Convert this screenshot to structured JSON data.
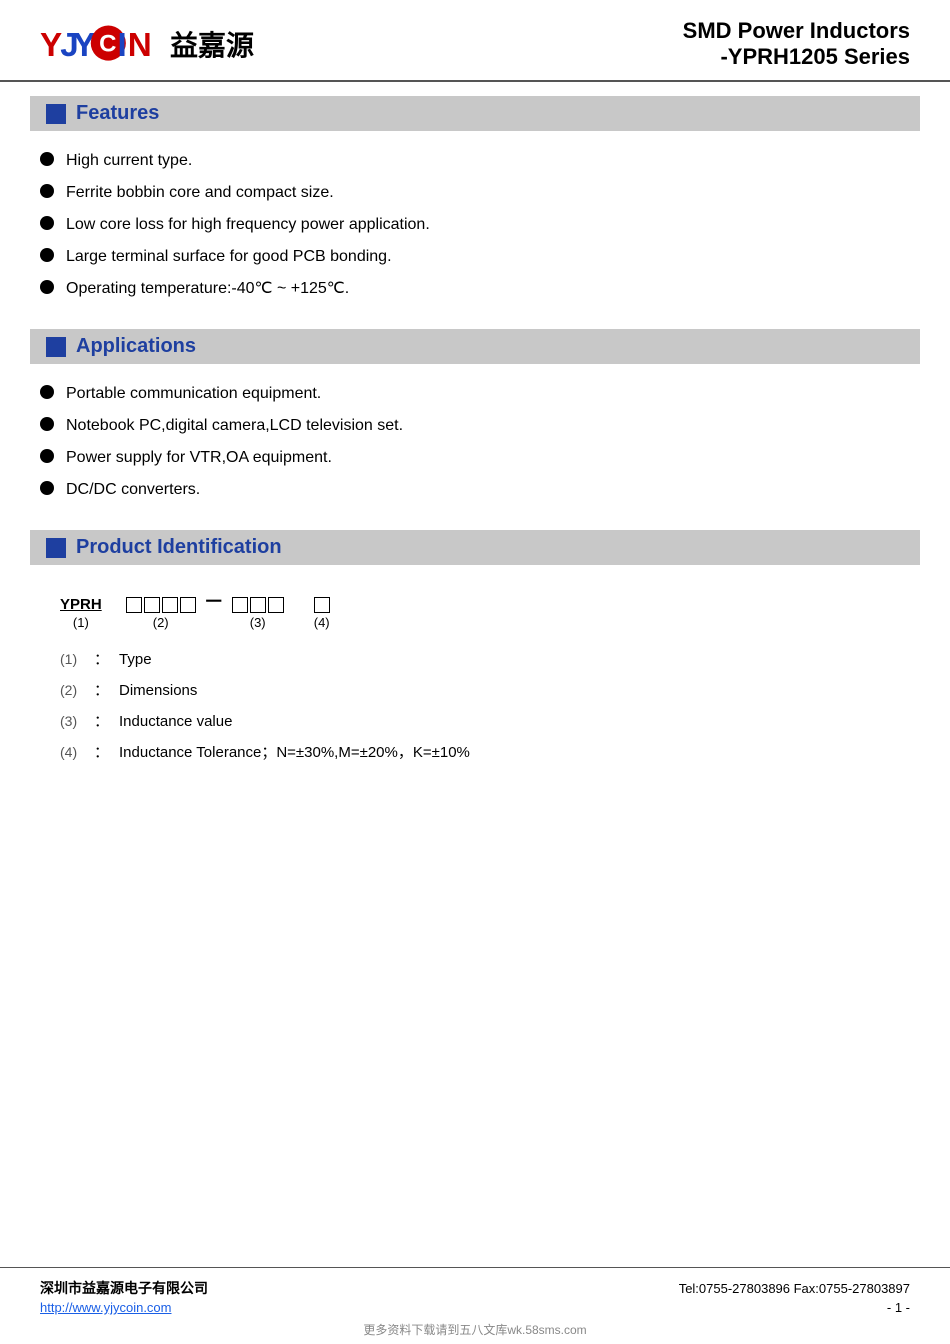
{
  "header": {
    "logo_cn": "益嘉源",
    "title_line1": "SMD Power Inductors",
    "title_line2": "-YPRH1205 Series"
  },
  "sections": {
    "features": {
      "title": "Features",
      "items": [
        "High current type.",
        "Ferrite bobbin core and compact size.",
        "Low core loss for high frequency power application.",
        "Large terminal surface for good PCB bonding.",
        "Operating temperature:-40℃ ~ +125℃."
      ]
    },
    "applications": {
      "title": "Applications",
      "items": [
        "Portable communication equipment.",
        "Notebook PC,digital camera,LCD television set.",
        "Power supply for VTR,OA equipment.",
        "DC/DC converters."
      ]
    },
    "product_id": {
      "title": "Product Identification",
      "diagram": {
        "prefix": "YPRH",
        "group1_label": "(1)",
        "group2_boxes": 4,
        "group2_label": "(2)",
        "group3_boxes": 3,
        "group3_label": "(3)",
        "group4_boxes": 1,
        "group4_label": "(4)"
      },
      "legend": [
        {
          "num": "(1)",
          "desc": "Type"
        },
        {
          "num": "(2)",
          "desc": "Dimensions"
        },
        {
          "num": "(3)",
          "desc": "Inductance value"
        },
        {
          "num": "(4)",
          "desc": "Inductance Tolerance；N=±30%,M=±20%，K=±10%"
        }
      ]
    }
  },
  "footer": {
    "company": "深圳市益嘉源电子有限公司",
    "contact": "Tel:0755-27803896   Fax:0755-27803897",
    "website": "http://www.yjycoin.com",
    "page": "- 1 -",
    "watermark": "更多资料下载请到五八文库wk.58sms.com"
  }
}
